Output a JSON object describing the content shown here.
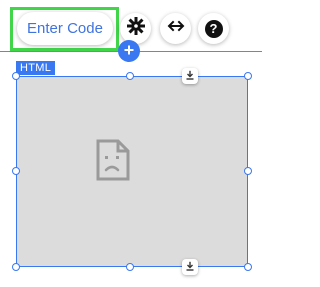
{
  "toolbar": {
    "enter_code_label": "Enter Code",
    "settings_icon": "gear-icon",
    "stretch_icon": "horizontal-arrows-icon",
    "help_icon": "question-mark-icon",
    "help_glyph": "?",
    "add_icon": "plus-icon"
  },
  "element": {
    "tag_label": "HTML",
    "placeholder_icon": "broken-document-icon",
    "download_icon": "download-icon"
  },
  "colors": {
    "accent": "#3a78f2",
    "highlight": "#41d64a",
    "frame_fill": "#dcdcdc",
    "guide_line": "#5b8ad8"
  }
}
